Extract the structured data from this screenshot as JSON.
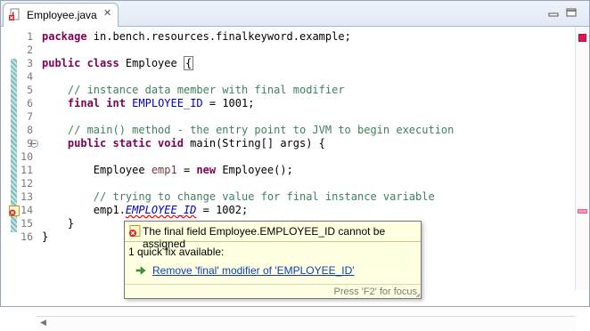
{
  "tab": {
    "label": "Employee.java",
    "close_glyph": "✕"
  },
  "editor": {
    "line_numbers": [
      "1",
      "2",
      "3",
      "4",
      "5",
      "6",
      "7",
      "8",
      "9",
      "10",
      "11",
      "12",
      "13",
      "14",
      "15",
      "16"
    ],
    "code": {
      "l1_kw": "package",
      "l1_rest": " in.bench.resources.finalkeyword.example;",
      "l3_kw": "public class",
      "l3_name": " Employee ",
      "l3_brace": "{",
      "l5_comment": "    // instance data member with final modifier",
      "l6_indent": "    ",
      "l6_kw": "final int",
      "l6_space": " ",
      "l6_field": "EMPLOYEE_ID",
      "l6_rest": " = 1001;",
      "l8_comment": "    // main() method - the entry point to JVM to begin execution",
      "l9_indent": "    ",
      "l9_kw": "public static void",
      "l9_rest": " main(String[] args) {",
      "l11_pre": "        Employee ",
      "l11_var": "emp1",
      "l11_mid": " = ",
      "l11_kw": "new",
      "l11_rest": " Employee();",
      "l13_comment": "        // trying to change value for final instance variable",
      "l14_pre": "        emp1.",
      "l14_field": "EMPLOYEE_ID",
      "l14_rest": " = 1002;",
      "l15": "    }",
      "l16": "}"
    }
  },
  "popup": {
    "error_message": "The final field Employee.EMPLOYEE_ID cannot be assigned",
    "quick_fix_count": "1 quick fix available:",
    "fix_label": "Remove 'final' modifier of 'EMPLOYEE_ID'",
    "focus_hint": "Press 'F2' for focus"
  },
  "colors": {
    "keyword": "#7f0055",
    "comment": "#3f7f5f",
    "field": "#0000c0",
    "link": "#0b3fc1",
    "tooltip_bg": "#ffffe1",
    "error": "#ff0000"
  },
  "icons": [
    "java-file-icon",
    "close-icon",
    "minimize-icon",
    "maximize-icon",
    "error-marker-icon",
    "fold-minus-icon",
    "quick-fix-icon",
    "overview-error-icon"
  ]
}
